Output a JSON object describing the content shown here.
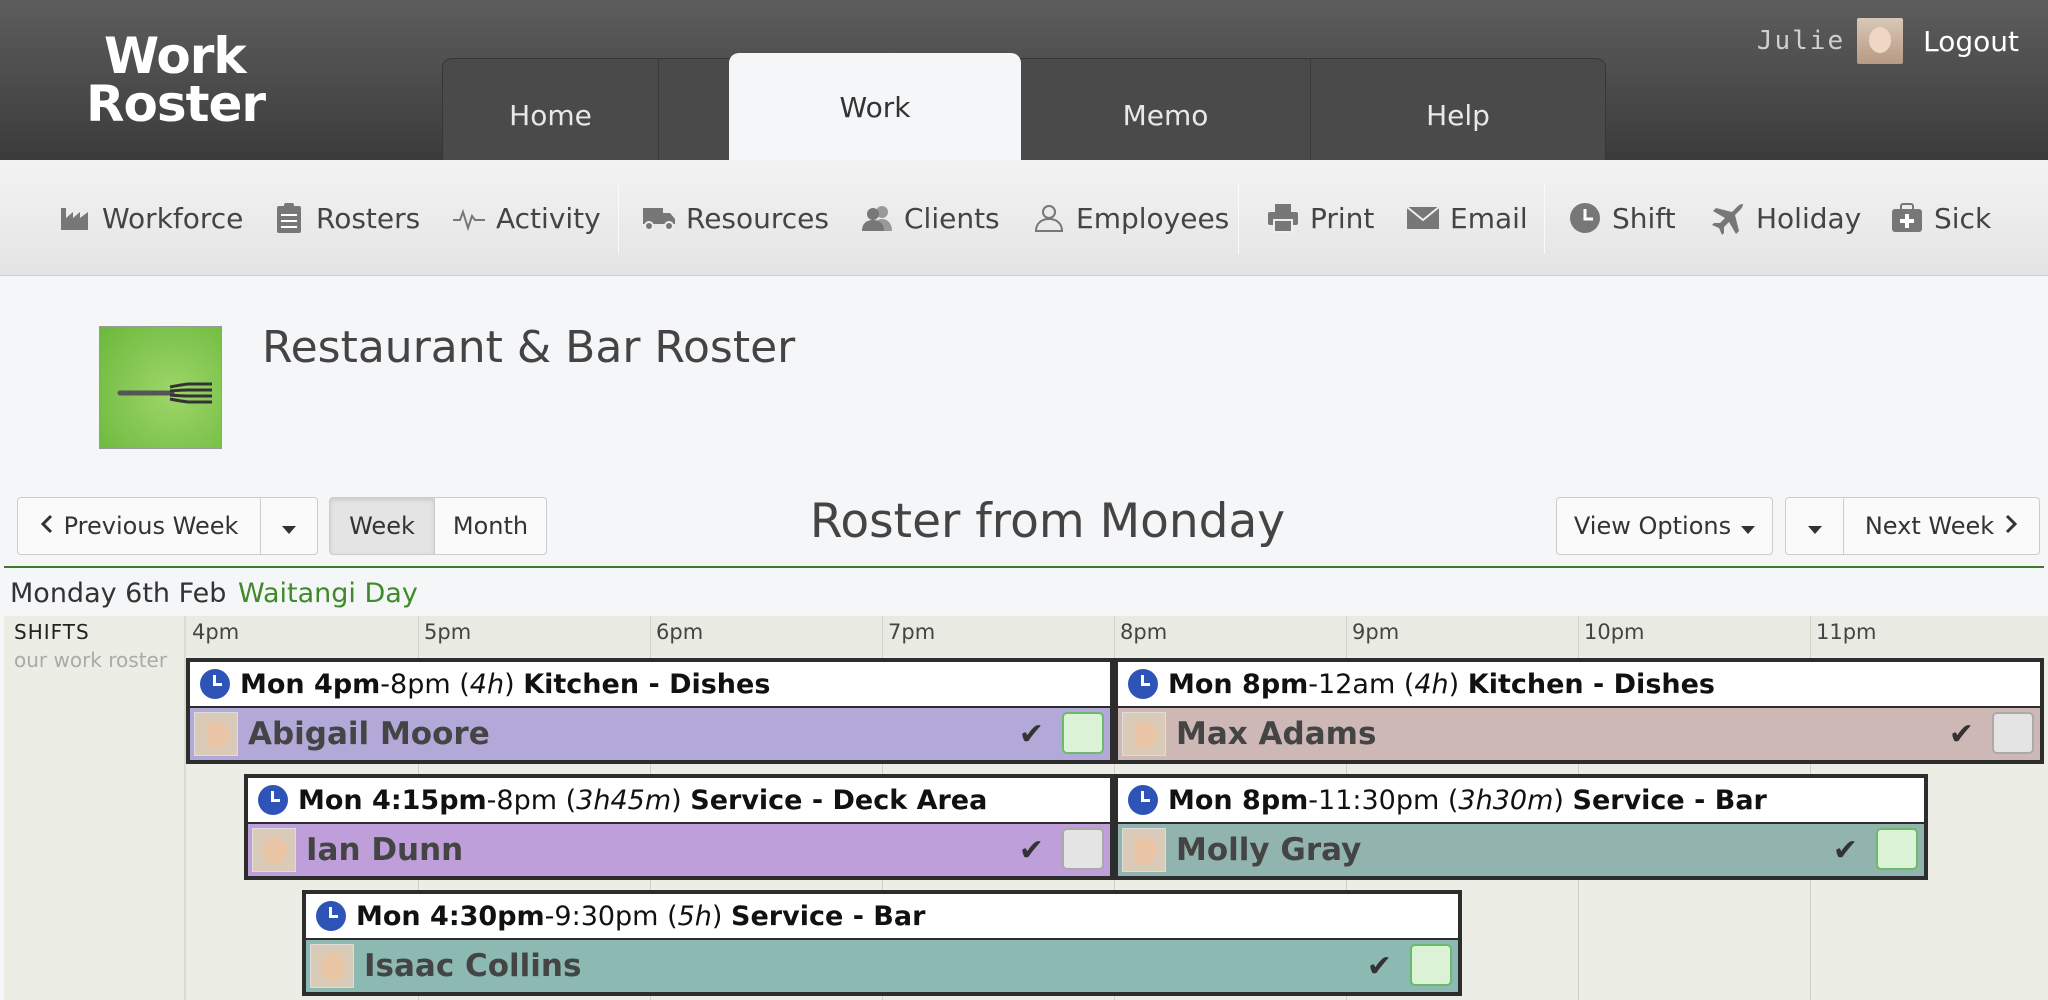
{
  "app": {
    "logo_line1": "Work",
    "logo_line2": "Roster"
  },
  "tabs": [
    {
      "label": "Home"
    },
    {
      "label": "Work"
    },
    {
      "label": "Memo"
    },
    {
      "label": "Help"
    }
  ],
  "user": {
    "name": "Julie",
    "logout": "Logout"
  },
  "toolbar": [
    {
      "label": "Workforce",
      "icon": "factory-icon"
    },
    {
      "label": "Rosters",
      "icon": "clipboard-icon"
    },
    {
      "label": "Activity",
      "icon": "pulse-icon"
    },
    {
      "label": "Resources",
      "icon": "truck-icon"
    },
    {
      "label": "Clients",
      "icon": "clients-icon"
    },
    {
      "label": "Employees",
      "icon": "person-icon"
    },
    {
      "label": "Print",
      "icon": "printer-icon"
    },
    {
      "label": "Email",
      "icon": "envelope-icon"
    },
    {
      "label": "Shift",
      "icon": "clock-icon"
    },
    {
      "label": "Holiday",
      "icon": "plane-icon"
    },
    {
      "label": "Sick",
      "icon": "medkit-icon"
    }
  ],
  "roster": {
    "title": "Restaurant & Bar Roster"
  },
  "nav": {
    "prev": "Previous Week",
    "week": "Week",
    "month": "Month",
    "title": "Roster from Monday",
    "view_options": "View Options",
    "next": "Next Week"
  },
  "day": {
    "label": "Monday 6th Feb",
    "holiday": "Waitangi Day"
  },
  "grid": {
    "shifts_label": "SHIFTS",
    "shifts_sub": "our work roster",
    "hours": [
      "4pm",
      "5pm",
      "6pm",
      "7pm",
      "8pm",
      "9pm",
      "10pm",
      "11pm"
    ]
  },
  "shifts": [
    {
      "start": "Mon 4pm",
      "end": "-8pm",
      "duration": "4h",
      "role": "Kitchen - Dishes",
      "employee": "Abigail Moore",
      "color": "#b3a9d9",
      "confirmed": true
    },
    {
      "start": "Mon 8pm",
      "end": "-12am",
      "duration": "4h",
      "role": "Kitchen - Dishes",
      "employee": "Max Adams",
      "color": "#cdb8b6",
      "confirmed": false
    },
    {
      "start": "Mon 4:15pm",
      "end": "-8pm",
      "duration": "3h45m",
      "role": "Service - Deck Area",
      "employee": "Ian Dunn",
      "color": "#bf9fd9",
      "confirmed": false
    },
    {
      "start": "Mon 8pm",
      "end": "-11:30pm",
      "duration": "3h30m",
      "role": "Service - Bar",
      "employee": "Molly Gray",
      "color": "#91b5ae",
      "confirmed": true
    },
    {
      "start": "Mon 4:30pm",
      "end": "-9:30pm",
      "duration": "5h",
      "role": "Service - Bar",
      "employee": "Isaac Collins",
      "color": "#8cb9b2",
      "confirmed": true
    }
  ]
}
